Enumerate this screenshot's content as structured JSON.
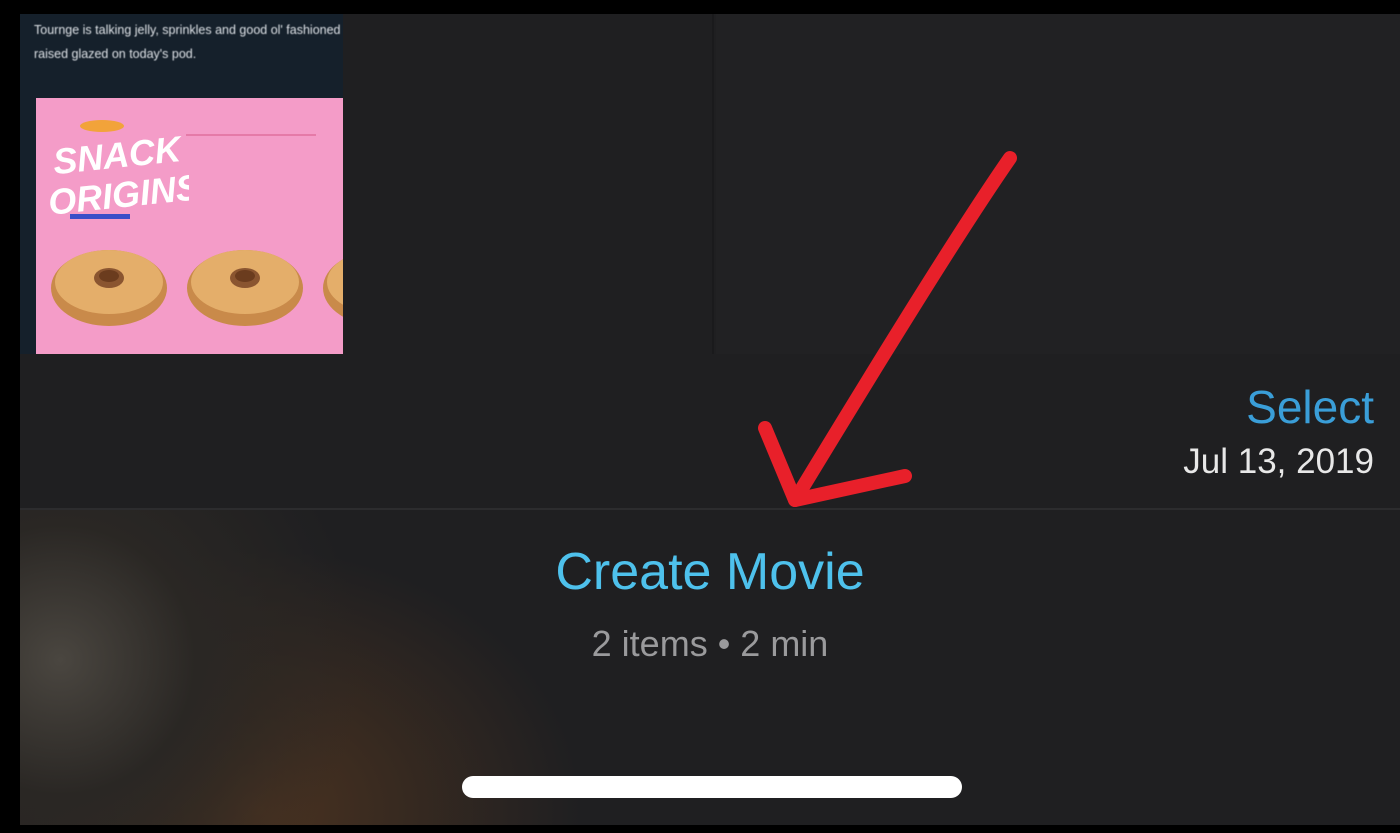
{
  "tweet": {
    "text": "Tournge is talking jelly, sprinkles and good ol' fashioned raised glazed on today's pod.",
    "image_title_line1": "SNACK",
    "image_title_line2": "ORIGINS"
  },
  "header": {
    "select_label": "Select",
    "date": "Jul 13, 2019"
  },
  "movie": {
    "create_label": "Create Movie",
    "meta": "2 items • 2 min"
  },
  "colors": {
    "accent": "#4ec1ec",
    "select": "#3a9ed8",
    "annotation": "#e8202a"
  }
}
